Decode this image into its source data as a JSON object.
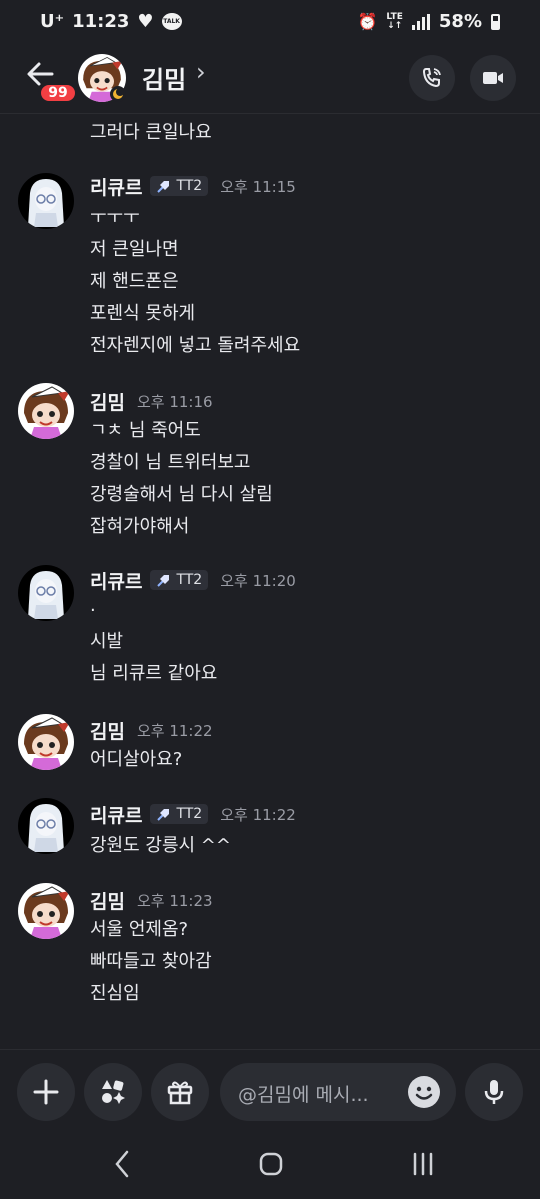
{
  "status": {
    "carrier": "U⁺",
    "time": "11:23",
    "talk": "TALK",
    "lte": "LTE",
    "battery": "58%"
  },
  "header": {
    "unread_badge": "99",
    "name": "김밈",
    "chevron": "›"
  },
  "messages": {
    "first": {
      "lines": [
        "그러다 큰일나요"
      ]
    },
    "g1": {
      "user": "리큐르",
      "tag": "TT2",
      "time": "오후 11:15",
      "lines": [
        "ㅜㅜㅜ",
        "저 큰일나면",
        "제 핸드폰은",
        "포렌식 못하게",
        "전자렌지에 넣고 돌려주세요"
      ]
    },
    "g2": {
      "user": "김밈",
      "time": "오후 11:16",
      "lines": [
        "ㄱㅊ 님 죽어도",
        "경찰이 님 트위터보고",
        "강령술해서 님 다시 살림",
        "잡혀가야해서"
      ]
    },
    "g3": {
      "user": "리큐르",
      "tag": "TT2",
      "time": "오후 11:20",
      "lines": [
        ".",
        "시발",
        "님 리큐르 같아요"
      ]
    },
    "g4": {
      "user": "김밈",
      "time": "오후 11:22",
      "lines": [
        "어디살아요?"
      ]
    },
    "g5": {
      "user": "리큐르",
      "tag": "TT2",
      "time": "오후 11:22",
      "lines": [
        "강원도 강릉시 ^^"
      ]
    },
    "g6": {
      "user": "김밈",
      "time": "오후 11:23",
      "lines": [
        "서울 언제옴?",
        "빠따들고 찾아감",
        "진심임"
      ]
    }
  },
  "composer": {
    "placeholder": "@김밈에 메시..."
  },
  "colors": {
    "background": "#1e1f24",
    "badge": "#f23f43",
    "button_bg": "#2b2d33",
    "timestamp": "#9a9ca5"
  },
  "icons": [
    "arrow-left-icon",
    "chevron-right-icon",
    "phone-call-icon",
    "video-camera-icon",
    "plus-icon",
    "apps-icon",
    "gift-icon",
    "emoji-icon",
    "microphone-icon",
    "nav-back-icon",
    "nav-home-icon",
    "nav-recents-icon"
  ]
}
